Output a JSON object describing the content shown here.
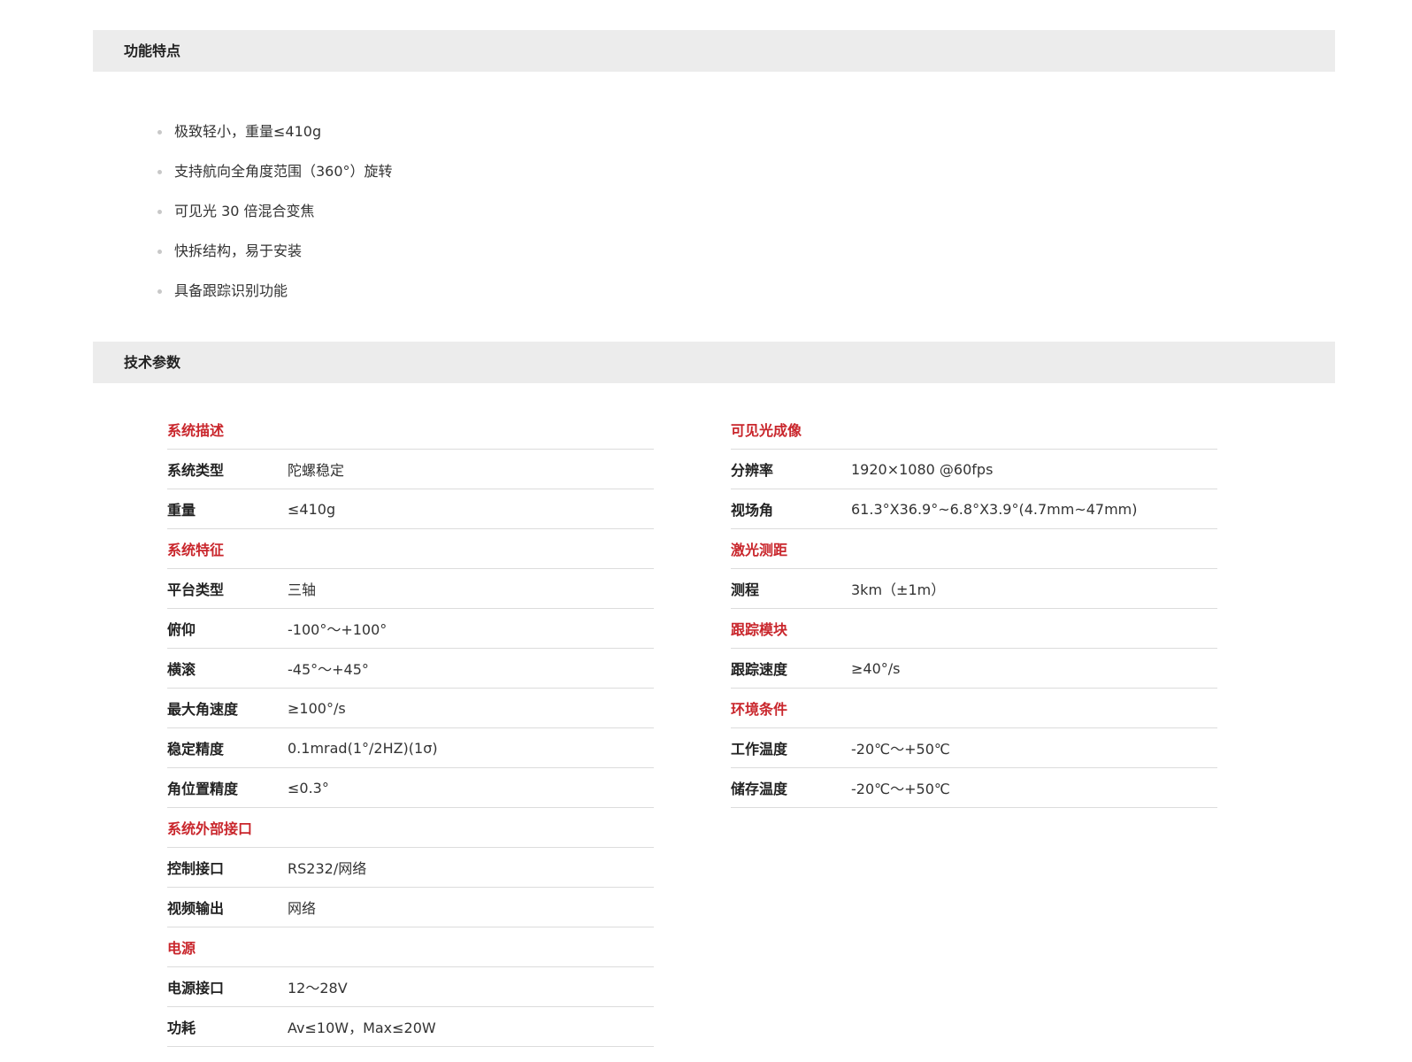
{
  "sections": {
    "features_title": "功能特点",
    "specs_title": "技术参数"
  },
  "features": [
    "极致轻小，重量≤410g",
    "支持航向全角度范围（360°）旋转",
    "可见光 30 倍混合变焦",
    "快拆结构，易于安装",
    "具备跟踪识别功能"
  ],
  "specs_left": [
    {
      "type": "category",
      "label": "系统描述"
    },
    {
      "type": "row",
      "key": "系统类型",
      "value": "陀螺稳定"
    },
    {
      "type": "row",
      "key": "重量",
      "value": "≤410g"
    },
    {
      "type": "category",
      "label": "系统特征"
    },
    {
      "type": "row",
      "key": "平台类型",
      "value": "三轴"
    },
    {
      "type": "row",
      "key": "俯仰",
      "value": "-100°～+100°"
    },
    {
      "type": "row",
      "key": "横滚",
      "value": "-45°～+45°"
    },
    {
      "type": "row",
      "key": "最大角速度",
      "value": "≥100°/s"
    },
    {
      "type": "row",
      "key": "稳定精度",
      "value": "0.1mrad(1°/2HZ)(1σ)"
    },
    {
      "type": "row",
      "key": "角位置精度",
      "value": "≤0.3°"
    },
    {
      "type": "category",
      "label": "系统外部接口"
    },
    {
      "type": "row",
      "key": "控制接口",
      "value": "RS232/网络"
    },
    {
      "type": "row",
      "key": "视频输出",
      "value": "网络"
    },
    {
      "type": "category",
      "label": "电源"
    },
    {
      "type": "row",
      "key": "电源接口",
      "value": "12～28V"
    },
    {
      "type": "row",
      "key": "功耗",
      "value": "Av≤10W，Max≤20W"
    }
  ],
  "specs_right": [
    {
      "type": "category",
      "label": "可见光成像"
    },
    {
      "type": "row",
      "key": "分辨率",
      "value": "1920×1080 @60fps"
    },
    {
      "type": "row",
      "key": "视场角",
      "value": "61.3°X36.9°~6.8°X3.9°(4.7mm~47mm)"
    },
    {
      "type": "category",
      "label": "激光测距"
    },
    {
      "type": "row",
      "key": "测程",
      "value": "3km（±1m）"
    },
    {
      "type": "category",
      "label": "跟踪模块"
    },
    {
      "type": "row",
      "key": "跟踪速度",
      "value": "≥40°/s"
    },
    {
      "type": "category",
      "label": "环境条件"
    },
    {
      "type": "row",
      "key": "工作温度",
      "value": "-20℃～+50℃"
    },
    {
      "type": "row",
      "key": "储存温度",
      "value": "-20℃～+50℃"
    }
  ],
  "colors": {
    "category": "#c9262c",
    "header_bg": "#ececec",
    "divider": "#dcdcdc"
  }
}
